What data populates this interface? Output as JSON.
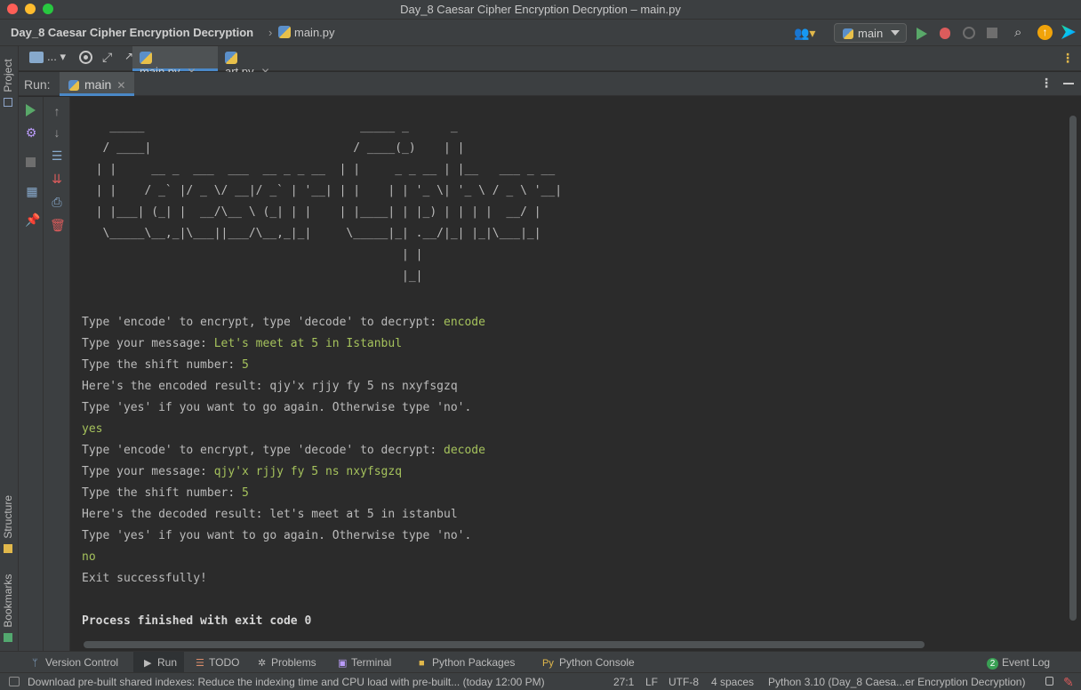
{
  "window": {
    "title": "Day_8 Caesar Cipher Encryption Decryption – main.py"
  },
  "navbar": {
    "project_name": "Day_8 Caesar Cipher Encryption Decryption",
    "separator": "›",
    "file_name": "main.py",
    "run_config": "main"
  },
  "left_stripe": {
    "project": "Project",
    "structure": "Structure",
    "bookmarks": "Bookmarks"
  },
  "editor_tabs": {
    "more": "...",
    "tabs": [
      {
        "label": "main.py",
        "active": true
      },
      {
        "label": "art.py",
        "active": false
      }
    ]
  },
  "run_window": {
    "label": "Run:",
    "tab_label": "main"
  },
  "console": {
    "ascii_art": [
      "    _____                               _____ _      _",
      "   / ____|                             / ____(_)    | |",
      "  | |     __ _  ___  ___  __ _ _ __  | |     _ _ __ | |__   ___ _ __",
      "  | |    / _` |/ _ \\/ __|/ _` | '__| | |    | | '_ \\| '_ \\ / _ \\ '__|",
      "  | |___| (_| |  __/\\__ \\ (_| | |    | |____| | |_) | | | |  __/ |",
      "   \\_____\\__,_|\\___||___/\\__,_|_|     \\_____|_| .__/|_| |_|\\___|_|",
      "                                              | |",
      "                                              |_|"
    ],
    "lines": [
      {
        "prompt": "Type 'encode' to encrypt, type 'decode' to decrypt: ",
        "input": "encode"
      },
      {
        "prompt": "Type your message: ",
        "input": "Let's meet at 5 in Istanbul"
      },
      {
        "prompt": "Type the shift number: ",
        "input": "5"
      },
      {
        "prompt": "Here's the encoded result: qjy'x rjjy fy 5 ns nxyfsgzq",
        "input": ""
      },
      {
        "prompt": "Type 'yes' if you want to go again. Otherwise type 'no'.",
        "input": ""
      },
      {
        "prompt": "",
        "input": "yes"
      },
      {
        "prompt": "Type 'encode' to encrypt, type 'decode' to decrypt: ",
        "input": "decode"
      },
      {
        "prompt": "Type your message: ",
        "input": "qjy'x rjjy fy 5 ns nxyfsgzq"
      },
      {
        "prompt": "Type the shift number: ",
        "input": "5"
      },
      {
        "prompt": "Here's the decoded result: let's meet at 5 in istanbul",
        "input": ""
      },
      {
        "prompt": "Type 'yes' if you want to go again. Otherwise type 'no'.",
        "input": ""
      },
      {
        "prompt": "",
        "input": "no"
      },
      {
        "prompt": "Exit successfully!",
        "input": ""
      },
      {
        "prompt": "",
        "input": ""
      }
    ],
    "exit_message": "Process finished with exit code 0"
  },
  "bottom_bar": {
    "version_control": "Version Control",
    "run": "Run",
    "todo": "TODO",
    "problems": "Problems",
    "terminal": "Terminal",
    "python_packages": "Python Packages",
    "python_console": "Python Console",
    "event_log": "Event Log",
    "event_count": "2"
  },
  "status_bar": {
    "message": "Download pre-built shared indexes: Reduce the indexing time and CPU load with pre-built... (today 12:00 PM)",
    "position": "27:1",
    "line_separator": "LF",
    "encoding": "UTF-8",
    "indent": "4 spaces",
    "interpreter": "Python 3.10 (Day_8 Caesa...er Encryption Decryption)"
  },
  "colors": {
    "background": "#2b2b2b",
    "panel": "#3c3f41",
    "user_input": "#a5c25c",
    "accent": "#4a88c7"
  }
}
